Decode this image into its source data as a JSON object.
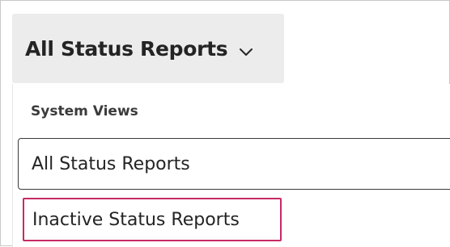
{
  "view_selector": {
    "label": "All Status Reports",
    "icon": "chevron-down-icon"
  },
  "dropdown": {
    "group_header": "System Views",
    "options": [
      {
        "label": "All Status Reports",
        "state": "selected"
      },
      {
        "label": "Inactive Status Reports",
        "state": "highlighted"
      }
    ]
  },
  "colors": {
    "selector_background": "#ececec",
    "highlight_border": "#c72a64",
    "selected_border": "#3a3a3a"
  }
}
